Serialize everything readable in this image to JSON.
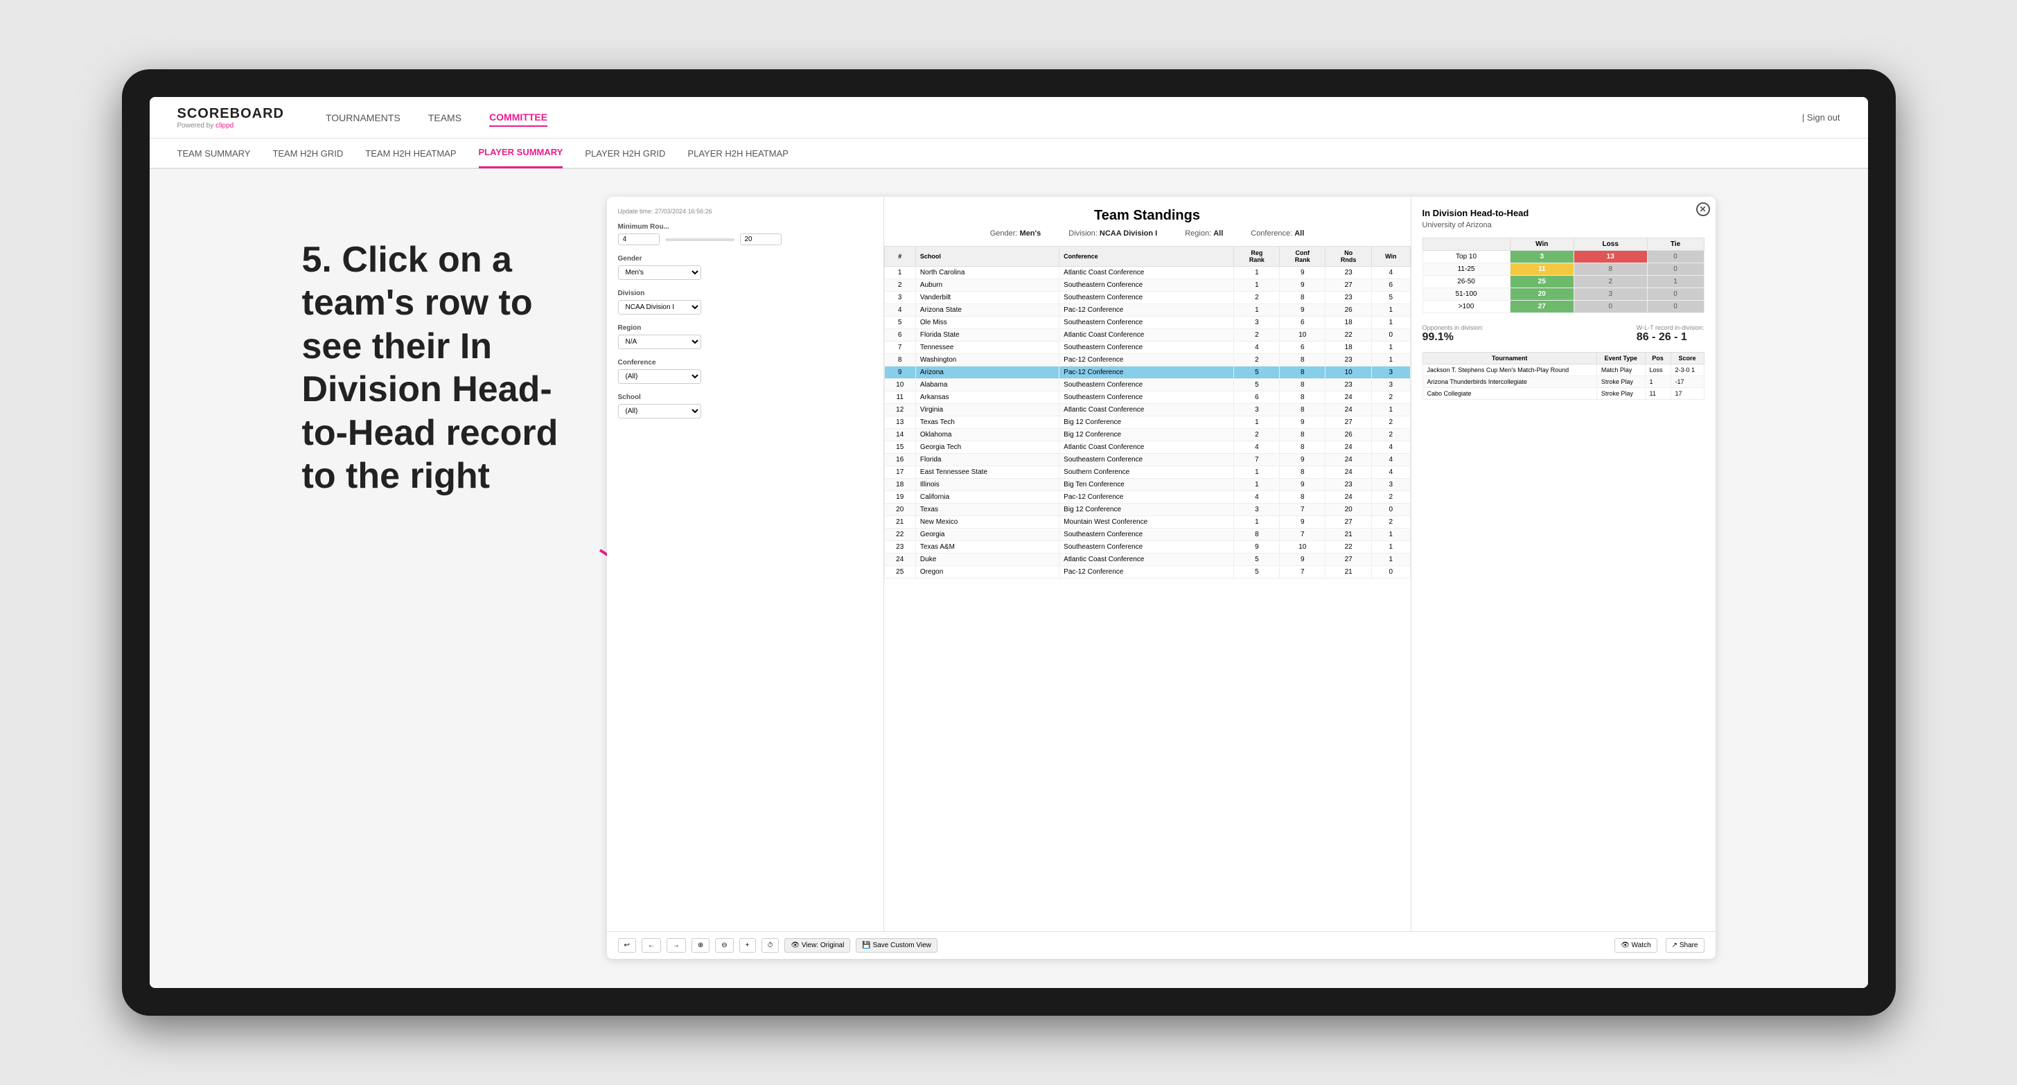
{
  "device": {
    "background": "#1a1a1a"
  },
  "annotation": {
    "text": "5. Click on a team's row to see their In Division Head-to-Head record to the right"
  },
  "navbar": {
    "logo": "SCOREBOARD",
    "logo_sub": "Powered by clippd",
    "nav_items": [
      "TOURNAMENTS",
      "TEAMS",
      "COMMITTEE"
    ],
    "active_nav": "COMMITTEE",
    "sign_out": "Sign out"
  },
  "sub_navbar": {
    "items": [
      "TEAM SUMMARY",
      "TEAM H2H GRID",
      "TEAM H2H HEATMAP",
      "PLAYER SUMMARY",
      "PLAYER H2H GRID",
      "PLAYER H2H HEATMAP"
    ],
    "active": "PLAYER SUMMARY"
  },
  "main": {
    "update_time": "Update time: 27/03/2024 16:56:26",
    "title": "Team Standings",
    "gender": "Men's",
    "division": "NCAA Division I",
    "region": "All",
    "conference": "All",
    "filters": {
      "minimum_rounds_label": "Minimum Rou...",
      "min_value": "4",
      "max_value": "20",
      "gender_label": "Gender",
      "gender_value": "Men's",
      "division_label": "Division",
      "division_value": "NCAA Division I",
      "region_label": "Region",
      "region_value": "N/A",
      "conference_label": "Conference",
      "conference_value": "(All)",
      "school_label": "School",
      "school_value": "(All)"
    },
    "table_headers": [
      "#",
      "School",
      "Conference",
      "Reg Rank",
      "Conf Rank",
      "No Rnds",
      "Win"
    ],
    "teams": [
      {
        "rank": 1,
        "school": "North Carolina",
        "conference": "Atlantic Coast Conference",
        "reg_rank": 1,
        "conf_rank": 9,
        "no_rnds": 23,
        "win": 4
      },
      {
        "rank": 2,
        "school": "Auburn",
        "conference": "Southeastern Conference",
        "reg_rank": 1,
        "conf_rank": 9,
        "no_rnds": 27,
        "win": 6
      },
      {
        "rank": 3,
        "school": "Vanderbilt",
        "conference": "Southeastern Conference",
        "reg_rank": 2,
        "conf_rank": 8,
        "no_rnds": 23,
        "win": 5
      },
      {
        "rank": 4,
        "school": "Arizona State",
        "conference": "Pac-12 Conference",
        "reg_rank": 1,
        "conf_rank": 9,
        "no_rnds": 26,
        "win": 1
      },
      {
        "rank": 5,
        "school": "Ole Miss",
        "conference": "Southeastern Conference",
        "reg_rank": 3,
        "conf_rank": 6,
        "no_rnds": 18,
        "win": 1
      },
      {
        "rank": 6,
        "school": "Florida State",
        "conference": "Atlantic Coast Conference",
        "reg_rank": 2,
        "conf_rank": 10,
        "no_rnds": 22,
        "win": 0
      },
      {
        "rank": 7,
        "school": "Tennessee",
        "conference": "Southeastern Conference",
        "reg_rank": 4,
        "conf_rank": 6,
        "no_rnds": 18,
        "win": 1
      },
      {
        "rank": 8,
        "school": "Washington",
        "conference": "Pac-12 Conference",
        "reg_rank": 2,
        "conf_rank": 8,
        "no_rnds": 23,
        "win": 1
      },
      {
        "rank": 9,
        "school": "Arizona",
        "conference": "Pac-12 Conference",
        "reg_rank": 5,
        "conf_rank": 8,
        "no_rnds": 10,
        "win": 3,
        "highlighted": true
      },
      {
        "rank": 10,
        "school": "Alabama",
        "conference": "Southeastern Conference",
        "reg_rank": 5,
        "conf_rank": 8,
        "no_rnds": 23,
        "win": 3
      },
      {
        "rank": 11,
        "school": "Arkansas",
        "conference": "Southeastern Conference",
        "reg_rank": 6,
        "conf_rank": 8,
        "no_rnds": 24,
        "win": 2
      },
      {
        "rank": 12,
        "school": "Virginia",
        "conference": "Atlantic Coast Conference",
        "reg_rank": 3,
        "conf_rank": 8,
        "no_rnds": 24,
        "win": 1
      },
      {
        "rank": 13,
        "school": "Texas Tech",
        "conference": "Big 12 Conference",
        "reg_rank": 1,
        "conf_rank": 9,
        "no_rnds": 27,
        "win": 2
      },
      {
        "rank": 14,
        "school": "Oklahoma",
        "conference": "Big 12 Conference",
        "reg_rank": 2,
        "conf_rank": 8,
        "no_rnds": 26,
        "win": 2
      },
      {
        "rank": 15,
        "school": "Georgia Tech",
        "conference": "Atlantic Coast Conference",
        "reg_rank": 4,
        "conf_rank": 8,
        "no_rnds": 24,
        "win": 4
      },
      {
        "rank": 16,
        "school": "Florida",
        "conference": "Southeastern Conference",
        "reg_rank": 7,
        "conf_rank": 9,
        "no_rnds": 24,
        "win": 4
      },
      {
        "rank": 17,
        "school": "East Tennessee State",
        "conference": "Southern Conference",
        "reg_rank": 1,
        "conf_rank": 8,
        "no_rnds": 24,
        "win": 4
      },
      {
        "rank": 18,
        "school": "Illinois",
        "conference": "Big Ten Conference",
        "reg_rank": 1,
        "conf_rank": 9,
        "no_rnds": 23,
        "win": 3
      },
      {
        "rank": 19,
        "school": "California",
        "conference": "Pac-12 Conference",
        "reg_rank": 4,
        "conf_rank": 8,
        "no_rnds": 24,
        "win": 2
      },
      {
        "rank": 20,
        "school": "Texas",
        "conference": "Big 12 Conference",
        "reg_rank": 3,
        "conf_rank": 7,
        "no_rnds": 20,
        "win": 0
      },
      {
        "rank": 21,
        "school": "New Mexico",
        "conference": "Mountain West Conference",
        "reg_rank": 1,
        "conf_rank": 9,
        "no_rnds": 27,
        "win": 2
      },
      {
        "rank": 22,
        "school": "Georgia",
        "conference": "Southeastern Conference",
        "reg_rank": 8,
        "conf_rank": 7,
        "no_rnds": 21,
        "win": 1
      },
      {
        "rank": 23,
        "school": "Texas A&M",
        "conference": "Southeastern Conference",
        "reg_rank": 9,
        "conf_rank": 10,
        "no_rnds": 22,
        "win": 1
      },
      {
        "rank": 24,
        "school": "Duke",
        "conference": "Atlantic Coast Conference",
        "reg_rank": 5,
        "conf_rank": 9,
        "no_rnds": 27,
        "win": 1
      },
      {
        "rank": 25,
        "school": "Oregon",
        "conference": "Pac-12 Conference",
        "reg_rank": 5,
        "conf_rank": 7,
        "no_rnds": 21,
        "win": 0
      }
    ]
  },
  "h2h_panel": {
    "title": "In Division Head-to-Head",
    "team": "University of Arizona",
    "table_headers": [
      "",
      "Win",
      "Loss",
      "Tie"
    ],
    "rows": [
      {
        "label": "Top 10",
        "win": 3,
        "loss": 13,
        "tie": 0,
        "win_color": "green",
        "loss_color": "red"
      },
      {
        "label": "11-25",
        "win": 11,
        "loss": 8,
        "tie": 0,
        "win_color": "yellow",
        "loss_color": "gray"
      },
      {
        "label": "26-50",
        "win": 25,
        "loss": 2,
        "tie": 1,
        "win_color": "green",
        "loss_color": "gray"
      },
      {
        "label": "51-100",
        "win": 20,
        "loss": 3,
        "tie": 0,
        "win_color": "green",
        "loss_color": "gray"
      },
      {
        "label": ">100",
        "win": 27,
        "loss": 0,
        "tie": 0,
        "win_color": "green",
        "loss_color": "gray"
      }
    ],
    "opponents_pct_label": "Opponents in division:",
    "opponents_pct": "99.1%",
    "record_label": "W-L-T record in-division:",
    "record": "86 - 26 - 1",
    "tournament_headers": [
      "Tournament",
      "Event Type",
      "Pos",
      "Score"
    ],
    "tournaments": [
      {
        "name": "Jackson T. Stephens Cup Men's Match-Play Round",
        "type": "Match Play",
        "pos": "Loss",
        "score": "2-3-0 1"
      },
      {
        "name": "Arizona Thunderbirds Intercollegiate",
        "type": "Stroke Play",
        "pos": "1",
        "score": "-17"
      },
      {
        "name": "Cabo Collegiate",
        "type": "Stroke Play",
        "pos": "11",
        "score": "17"
      }
    ]
  },
  "toolbar": {
    "undo": "↩",
    "redo": "↪",
    "view_original": "View: Original",
    "save_custom": "Save Custom View",
    "watch": "Watch",
    "share": "Share"
  }
}
